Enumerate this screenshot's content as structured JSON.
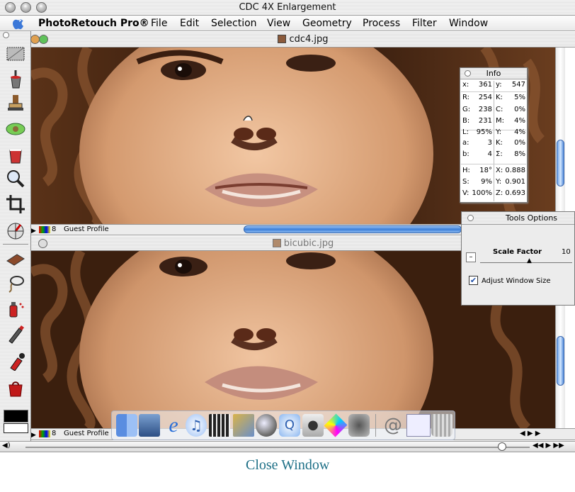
{
  "window": {
    "title": "CDC 4X Enlargement"
  },
  "menubar": {
    "app": "PhotoRetouch Pro®",
    "items": [
      "File",
      "Edit",
      "Selection",
      "View",
      "Geometry",
      "Process",
      "Filter",
      "Window"
    ]
  },
  "tools": [
    "marquee-tool-icon",
    "paint-bucket-icon",
    "rubber-stamp-icon",
    "hand-tool-icon",
    "eraser-bucket-icon",
    "magnifier-icon",
    "crop-icon",
    "color-picker-icon",
    "smudge-icon",
    "lasso-icon",
    "spray-paint-icon",
    "pen-icon",
    "dropper-icon",
    "shopping-bag-icon"
  ],
  "docs": [
    {
      "filename": "cdc4.jpg",
      "depth": "8",
      "profile": "Guest Profile"
    },
    {
      "filename": "bicubic.jpg",
      "depth": "8",
      "profile": "Guest Profile"
    }
  ],
  "info": {
    "title": "Info",
    "rows": [
      [
        "x:",
        "361",
        "y:",
        "547"
      ],
      [
        "R:",
        "254",
        "K:",
        "5%"
      ],
      [
        "G:",
        "238",
        "C:",
        "0%"
      ],
      [
        "B:",
        "231",
        "M:",
        "4%"
      ],
      [
        "L:",
        "95%",
        "Y:",
        "4%"
      ],
      [
        "a:",
        "3",
        "K:",
        "0%"
      ],
      [
        "b:",
        "4",
        "Σ:",
        "8%"
      ],
      [
        "H:",
        "18°",
        "X:",
        "0.888"
      ],
      [
        "S:",
        "9%",
        "Y:",
        "0.901"
      ],
      [
        "V:",
        "100%",
        "Z:",
        "0.693"
      ]
    ]
  },
  "tool_options": {
    "title": "Tools Options",
    "scale_label": "Scale Factor",
    "scale_value": "10",
    "minus": "–",
    "adjust_label": "Adjust Window Size",
    "adjust_checked": true
  },
  "dock": [
    "finder-icon",
    "system-prefs-icon",
    "internet-explorer-icon",
    "itunes-icon",
    "imovie-icon",
    "iphoto-icon",
    "sherlock-icon",
    "quicktime-icon",
    "apple-icon",
    "colorsync-icon",
    "camera-icon",
    "mail-icon",
    "desktop-icon",
    "trash-icon"
  ],
  "footer": {
    "close_window": "Close Window"
  },
  "colors": {
    "accent": "#3b7fd9",
    "link": "#1d6f86"
  }
}
